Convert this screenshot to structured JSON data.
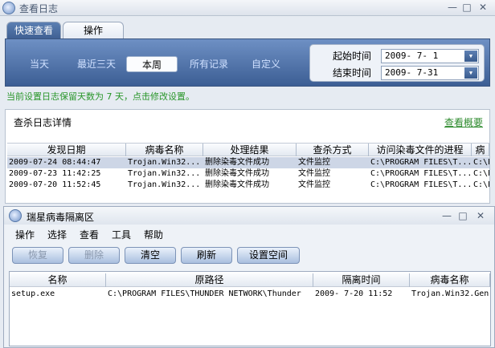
{
  "window": {
    "title": "查看日志"
  },
  "window_buttons": {
    "min": "—",
    "max": "□",
    "close": "✕"
  },
  "tabs": [
    {
      "label": "快速查看"
    },
    {
      "label": "操作"
    }
  ],
  "filters": [
    {
      "label": "当天"
    },
    {
      "label": "最近三天"
    },
    {
      "label": "本周",
      "selected": true
    },
    {
      "label": "所有记录"
    },
    {
      "label": "自定义"
    }
  ],
  "date_range": {
    "start_label": "起始时间",
    "start_value": "2009- 7- 1",
    "end_label": "结束时间",
    "end_value": "2009- 7-31"
  },
  "notice": {
    "prefix": "当前设置日志保留天数为",
    "days": "7",
    "suffix": "天，点击修改设置。"
  },
  "log": {
    "title": "查杀日志详情",
    "summary_link": "查看概要",
    "columns": [
      "发现日期",
      "病毒名称",
      "处理结果",
      "查杀方式",
      "访问染毒文件的进程",
      "病"
    ],
    "rows": [
      [
        "2009-07-24 08:44:47",
        "Trojan.Win32...",
        "删除染毒文件成功",
        "文件监控",
        "C:\\PROGRAM FILES\\T...",
        "C:\\P"
      ],
      [
        "2009-07-23 11:42:25",
        "Trojan.Win32...",
        "删除染毒文件成功",
        "文件监控",
        "C:\\PROGRAM FILES\\T...",
        "C:\\P"
      ],
      [
        "2009-07-20 11:52:45",
        "Trojan.Win32...",
        "删除染毒文件成功",
        "文件监控",
        "C:\\PROGRAM FILES\\T...",
        "C:\\P"
      ]
    ]
  },
  "quarantine": {
    "title": "瑞星病毒隔离区",
    "window_buttons": {
      "min": "—",
      "max": "□",
      "close": "✕"
    },
    "menu": [
      "操作",
      "选择",
      "查看",
      "工具",
      "帮助"
    ],
    "toolbar": [
      {
        "label": "恢复",
        "disabled": true
      },
      {
        "label": "删除",
        "disabled": true
      },
      {
        "label": "清空",
        "disabled": false
      },
      {
        "label": "刷新",
        "disabled": false
      },
      {
        "label": "设置空间",
        "disabled": false
      }
    ],
    "columns": [
      "名称",
      "原路径",
      "隔离时间",
      "病毒名称"
    ],
    "rows": [
      [
        "setup.exe",
        "C:\\PROGRAM FILES\\THUNDER NETWORK\\Thunder",
        "2009- 7-20 11:52",
        "Trojan.Win32.Gen"
      ]
    ]
  },
  "colors": {
    "accent": "#3e5f92",
    "notice": "#29962a",
    "selected_row": "#cdd6e6"
  }
}
